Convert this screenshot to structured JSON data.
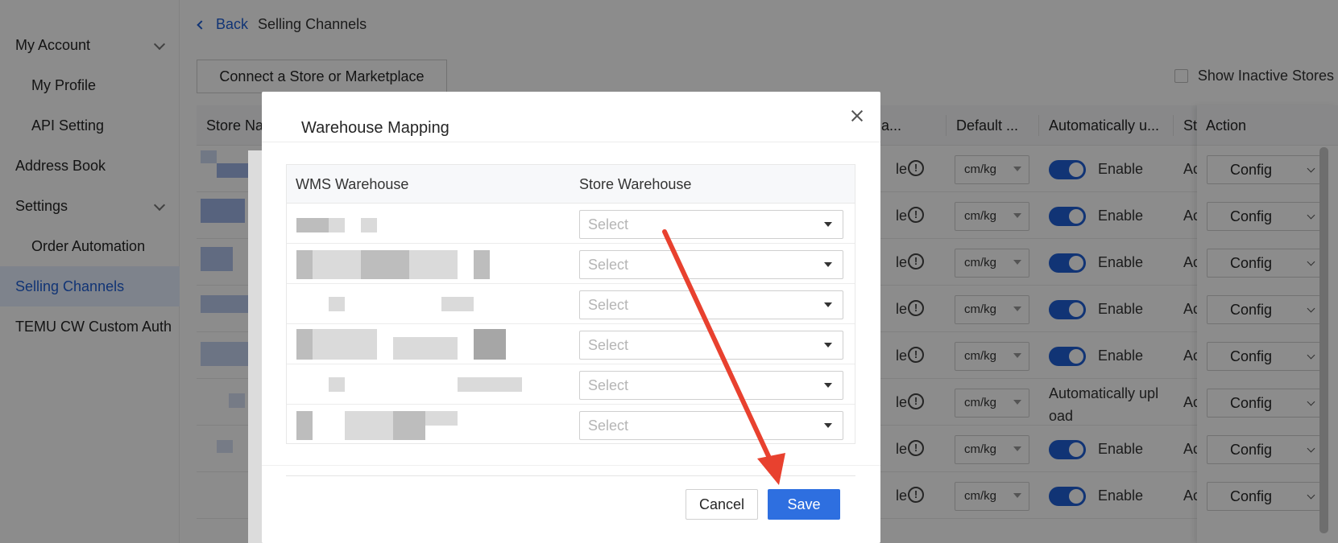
{
  "sidebar": {
    "items": [
      {
        "label": "My Account"
      },
      {
        "label": "My Profile"
      },
      {
        "label": "API Setting"
      },
      {
        "label": "Address Book"
      },
      {
        "label": "Settings"
      },
      {
        "label": "Order Automation"
      },
      {
        "label": "Selling Channels"
      },
      {
        "label": "TEMU CW Custom Auth"
      }
    ]
  },
  "breadcrumb": {
    "back": "Back",
    "current": "Selling Channels"
  },
  "toolbar": {
    "connect": "Connect a Store or Marketplace",
    "show_inactive": "Show Inactive Stores"
  },
  "table": {
    "headers": {
      "store": "Store Na",
      "update": "da...",
      "default_unit": "Default ...",
      "auto_upload": "Automatically u...",
      "status": "Statu",
      "action": "Action"
    },
    "rows": [
      {
        "left": "le",
        "unit": "cm/kg",
        "auto": "Enable",
        "status": "Activ",
        "action": "Config"
      },
      {
        "left": "le",
        "unit": "cm/kg",
        "auto": "Enable",
        "status": "Activ",
        "action": "Config"
      },
      {
        "left": "le",
        "unit": "cm/kg",
        "auto": "Enable",
        "status": "Activ",
        "action": "Config"
      },
      {
        "left": "le",
        "unit": "cm/kg",
        "auto": "Enable",
        "status": "Activ",
        "action": "Config"
      },
      {
        "left": "le",
        "unit": "cm/kg",
        "auto": "Enable",
        "status": "Activ",
        "action": "Config"
      },
      {
        "left": "le",
        "unit": "cm/kg",
        "auto": "Automatically upl oad",
        "status": "Activ",
        "action": "Config"
      },
      {
        "left": "le",
        "unit": "cm/kg",
        "auto": "Enable",
        "status": "Activ",
        "action": "Config"
      },
      {
        "left": "le",
        "unit": "cm/kg",
        "auto": "Enable",
        "status": "Activ",
        "action": "Config"
      }
    ]
  },
  "modal": {
    "title": "Warehouse Mapping",
    "col_wms": "WMS Warehouse",
    "col_store": "Store Warehouse",
    "select_placeholder": "Select",
    "cancel": "Cancel",
    "save": "Save"
  },
  "colors": {
    "primary": "#2e6fe0",
    "annotation_arrow": "#e8412f"
  }
}
